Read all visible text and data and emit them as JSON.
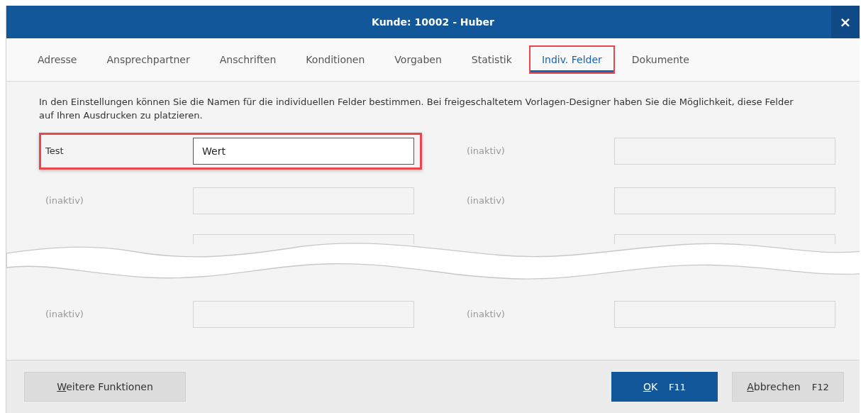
{
  "window": {
    "title": "Kunde: 10002 - Huber",
    "close": "×"
  },
  "tabs": [
    {
      "label": "Adresse",
      "selected": false,
      "highlighted": false
    },
    {
      "label": "Ansprechpartner",
      "selected": false,
      "highlighted": false
    },
    {
      "label": "Anschriften",
      "selected": false,
      "highlighted": false
    },
    {
      "label": "Konditionen",
      "selected": false,
      "highlighted": false
    },
    {
      "label": "Vorgaben",
      "selected": false,
      "highlighted": false
    },
    {
      "label": "Statistik",
      "selected": false,
      "highlighted": false
    },
    {
      "label": "Indiv. Felder",
      "selected": true,
      "highlighted": true
    },
    {
      "label": "Dokumente",
      "selected": false,
      "highlighted": false
    }
  ],
  "description": "In den Einstellungen können Sie die Namen für die individuellen Felder bestimmen. Bei freigeschaltetem Vorlagen-Designer haben Sie die Möglichkeit, diese Felder auf Ihren Ausdrucken zu platzieren.",
  "rows": [
    {
      "kind": "fields",
      "cells": [
        {
          "label": "Test",
          "value": "Wert",
          "active": true,
          "highlighted": true
        },
        {
          "label": "(inaktiv)",
          "active": false,
          "highlighted": false
        }
      ]
    },
    {
      "kind": "fields",
      "cells": [
        {
          "label": "(inaktiv)",
          "active": false,
          "highlighted": false
        },
        {
          "label": "(inaktiv)",
          "active": false,
          "highlighted": false
        }
      ]
    },
    {
      "kind": "break"
    },
    {
      "kind": "fields",
      "cells": [
        {
          "label": "(inaktiv)",
          "active": false,
          "highlighted": false
        },
        {
          "label": "(inaktiv)",
          "active": false,
          "highlighted": false
        }
      ]
    }
  ],
  "footer": {
    "left_button": {
      "accel": "W",
      "rest": "eitere Funktionen"
    },
    "buttons": [
      {
        "accel": "O",
        "rest": "K",
        "key": "F11",
        "primary": true
      },
      {
        "accel": "A",
        "rest": "bbrechen",
        "key": "F12",
        "primary": false
      }
    ]
  }
}
